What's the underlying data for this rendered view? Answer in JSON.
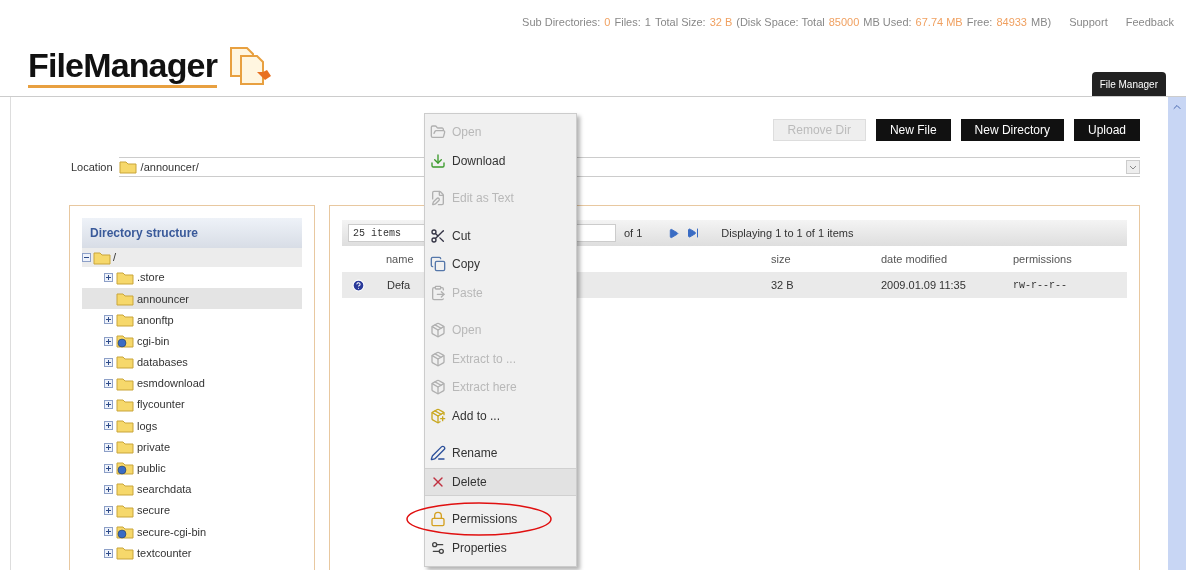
{
  "stats": [
    {
      "text": "Sub Directories:",
      "highlight": false
    },
    {
      "text": "0",
      "highlight": true
    },
    {
      "text": "Files:",
      "highlight": false
    },
    {
      "text": "1",
      "highlight": false
    },
    {
      "text": "Total Size:",
      "highlight": false
    },
    {
      "text": "32 B",
      "highlight": true
    },
    {
      "text": "(Disk Space: Total",
      "highlight": false
    },
    {
      "text": "85000",
      "highlight": true
    },
    {
      "text": "MB Used:",
      "highlight": false
    },
    {
      "text": "67.74 MB",
      "highlight": true
    },
    {
      "text": "Free:",
      "highlight": false
    },
    {
      "text": "84933",
      "highlight": true
    },
    {
      "text": "MB)",
      "highlight": false
    }
  ],
  "top_links": [
    "Support",
    "Feedback"
  ],
  "logo": "FileManager",
  "header_tab": {
    "label": "File Manager",
    "selected": true
  },
  "toolbar_buttons": [
    {
      "label": "Remove Dir",
      "disabled": true
    },
    {
      "label": "New File",
      "disabled": false
    },
    {
      "label": "New Directory",
      "disabled": false
    },
    {
      "label": "Upload",
      "disabled": false
    }
  ],
  "location": {
    "label": "Location",
    "value": "/announcer/"
  },
  "tree": {
    "title": "Directory structure",
    "root": {
      "label": "/",
      "expanded": true,
      "selected": false,
      "children": [
        {
          "label": ".store",
          "kind": "folder",
          "expandable": true,
          "selected": false
        },
        {
          "label": "announcer",
          "kind": "folder",
          "expandable": false,
          "selected": true
        },
        {
          "label": "anonftp",
          "kind": "folder",
          "expandable": true,
          "selected": false
        },
        {
          "label": "cgi-bin",
          "kind": "web",
          "expandable": true,
          "selected": false
        },
        {
          "label": "databases",
          "kind": "folder",
          "expandable": true,
          "selected": false
        },
        {
          "label": "esmdownload",
          "kind": "folder",
          "expandable": true,
          "selected": false
        },
        {
          "label": "flycounter",
          "kind": "folder",
          "expandable": true,
          "selected": false
        },
        {
          "label": "logs",
          "kind": "folder",
          "expandable": true,
          "selected": false
        },
        {
          "label": "private",
          "kind": "folder",
          "expandable": true,
          "selected": false
        },
        {
          "label": "public",
          "kind": "web",
          "expandable": true,
          "selected": false
        },
        {
          "label": "searchdata",
          "kind": "folder",
          "expandable": true,
          "selected": false
        },
        {
          "label": "secure",
          "kind": "folder",
          "expandable": true,
          "selected": false
        },
        {
          "label": "secure-cgi-bin",
          "kind": "web",
          "expandable": true,
          "selected": false
        },
        {
          "label": "textcounter",
          "kind": "folder",
          "expandable": true,
          "selected": false
        }
      ]
    }
  },
  "pager": {
    "page_size": "25 items",
    "of": "of 1",
    "summary": "Displaying 1 to 1 of 1 items"
  },
  "table": {
    "columns": [
      "name",
      "size",
      "date modified",
      "permissions"
    ],
    "rows": [
      {
        "name": "Defa",
        "size": "32 B",
        "date_modified": "2009.01.09 11:35",
        "permissions": "rw-r--r--",
        "selected": true
      }
    ]
  },
  "context_menu": [
    {
      "kind": "item",
      "label": "Open",
      "disabled": true,
      "selected": false
    },
    {
      "kind": "item",
      "label": "Download",
      "disabled": false,
      "selected": false
    },
    {
      "kind": "separator"
    },
    {
      "kind": "item",
      "label": "Edit as Text",
      "disabled": true,
      "selected": false
    },
    {
      "kind": "separator"
    },
    {
      "kind": "item",
      "label": "Cut",
      "disabled": false,
      "selected": false
    },
    {
      "kind": "item",
      "label": "Copy",
      "disabled": false,
      "selected": false
    },
    {
      "kind": "item",
      "label": "Paste",
      "disabled": true,
      "selected": false
    },
    {
      "kind": "separator"
    },
    {
      "kind": "item",
      "label": "Open",
      "disabled": true,
      "selected": false
    },
    {
      "kind": "item",
      "label": "Extract to ...",
      "disabled": true,
      "selected": false
    },
    {
      "kind": "item",
      "label": "Extract here",
      "disabled": true,
      "selected": false
    },
    {
      "kind": "item",
      "label": "Add to ...",
      "disabled": false,
      "selected": false
    },
    {
      "kind": "separator"
    },
    {
      "kind": "item",
      "label": "Rename",
      "disabled": false,
      "selected": false
    },
    {
      "kind": "item",
      "label": "Delete",
      "disabled": false,
      "selected": true
    },
    {
      "kind": "separator"
    },
    {
      "kind": "item",
      "label": "Permissions",
      "disabled": false,
      "selected": false,
      "circled": true
    },
    {
      "kind": "item",
      "label": "Properties",
      "disabled": false,
      "selected": false
    }
  ]
}
